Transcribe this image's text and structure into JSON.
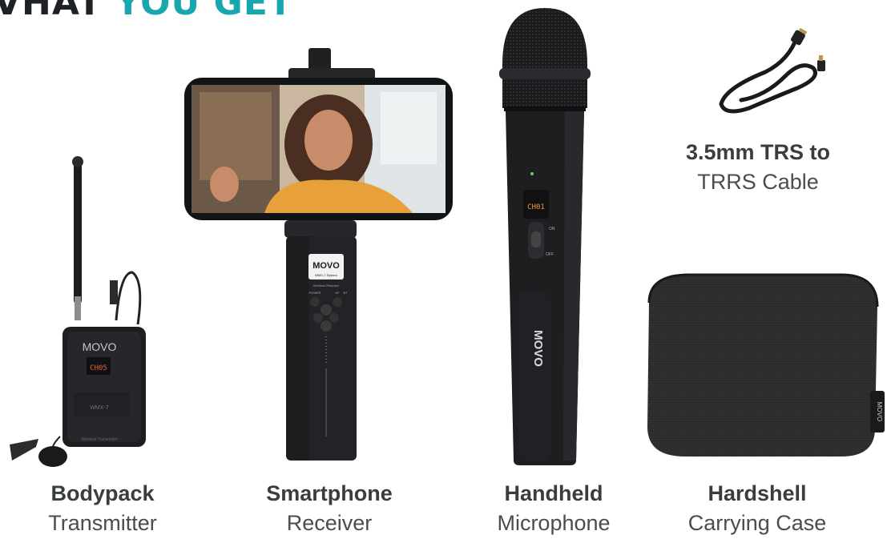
{
  "heading": {
    "word1": "VHAT",
    "word2": "YOU GET"
  },
  "colors": {
    "accent": "#18a7ae",
    "dark": "#1f2225",
    "caption": "#3a3d40"
  },
  "items": [
    {
      "id": "bodypack",
      "name_bold": "Bodypack",
      "name_light": "Transmitter",
      "brand": "MOVO",
      "model": "WMX-7",
      "display": "CH05",
      "sublabel": "Wireless Transmitter"
    },
    {
      "id": "smartphone-receiver",
      "name_bold": "Smartphone",
      "name_light": "Receiver",
      "brand": "MOVO",
      "model": "WMX-7 System",
      "sublabel": "Wireless Receiver",
      "button_power": "POWER",
      "button_hf": "HF",
      "button_bt": "BT"
    },
    {
      "id": "handheld-microphone",
      "name_bold": "Handheld",
      "name_light": "Microphone",
      "brand": "MOVO",
      "display": "CH01",
      "switch_on": "ON",
      "switch_off": "OFF"
    },
    {
      "id": "cable",
      "name_bold": "3.5mm TRS to",
      "name_light": "TRRS Cable"
    },
    {
      "id": "case",
      "name_bold": "Hardshell",
      "name_light": "Carrying Case",
      "brand": "MOVO"
    }
  ]
}
